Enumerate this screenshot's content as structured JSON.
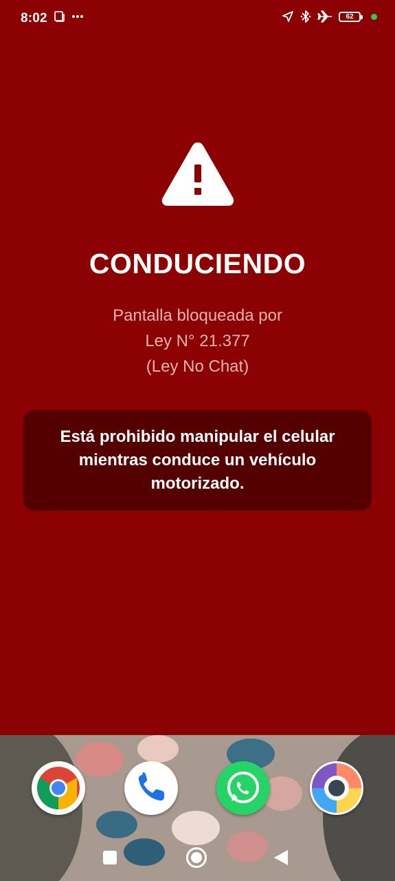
{
  "status_bar": {
    "time": "8:02",
    "battery_level": "62",
    "icons": [
      "screenshot-icon",
      "more-dots-icon",
      "location-arrow-icon",
      "bluetooth-icon",
      "airplane-mode-icon",
      "battery-icon",
      "green-indicator-dot"
    ]
  },
  "lock_screen": {
    "title": "CONDUCIENDO",
    "subtitle_line1": "Pantalla bloqueada por",
    "subtitle_line2": "Ley N° 21.377",
    "subtitle_line3": "(Ley No Chat)",
    "message_line1": "Está prohibido manipular el celular",
    "message_line2": "mientras conduce un vehículo",
    "message_line3": "motorizado."
  },
  "dock": {
    "apps": [
      "chrome-icon",
      "phone-icon",
      "whatsapp-icon",
      "browser-icon"
    ]
  },
  "nav_bar": {
    "buttons": [
      "recents-button",
      "home-button",
      "back-button"
    ]
  },
  "colors": {
    "background": "#8b0000",
    "message_box": "#550000",
    "subtitle_text": "#e8b3b3"
  }
}
